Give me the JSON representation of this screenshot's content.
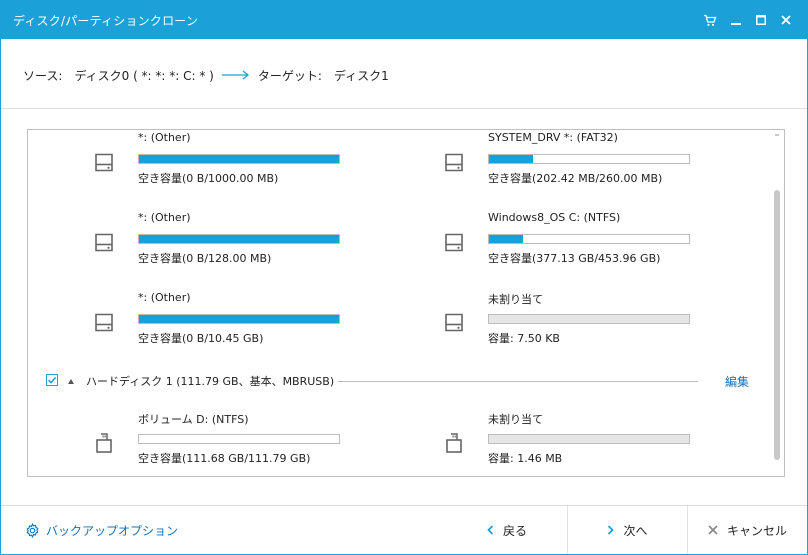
{
  "window": {
    "title": "ディスク/パーティションクローン",
    "accent": "#1ba1d8"
  },
  "source_target": {
    "source_label": "ソース:",
    "source_value": "ディスク0 ( *: *: *: C: * )",
    "target_label": "ターゲット:",
    "target_value": "ディスク1"
  },
  "disk0": {
    "partitions": [
      {
        "name": "*: (Other)",
        "capacity": "空き容量(0 B/1000.00 MB)",
        "used_fraction": 1.0,
        "unallocated": false
      },
      {
        "name": "SYSTEM_DRV *: (FAT32)",
        "capacity": "空き容量(202.42 MB/260.00 MB)",
        "used_fraction": 0.22,
        "unallocated": false
      },
      {
        "name": "*: (Other)",
        "capacity": "空き容量(0 B/128.00 MB)",
        "used_fraction": 1.0,
        "unallocated": false
      },
      {
        "name": "Windows8_OS C: (NTFS)",
        "capacity": "空き容量(377.13 GB/453.96 GB)",
        "used_fraction": 0.17,
        "unallocated": false
      },
      {
        "name": "*: (Other)",
        "capacity": "空き容量(0 B/10.45 GB)",
        "used_fraction": 1.0,
        "unallocated": false
      },
      {
        "name": "未割り当て",
        "capacity": "容量: 7.50 KB",
        "used_fraction": 0.0,
        "unallocated": true
      }
    ]
  },
  "disk1": {
    "label": "ハードディスク 1 (111.79 GB、基本、MBRUSB)",
    "edit_label": "編集",
    "checked": true,
    "partitions": [
      {
        "name": "ボリューム D: (NTFS)",
        "capacity": "空き容量(111.68 GB/111.79 GB)",
        "used_fraction": 0.0,
        "unallocated": false
      },
      {
        "name": "未割り当て",
        "capacity": "容量: 1.46 MB",
        "used_fraction": 0.0,
        "unallocated": true
      }
    ]
  },
  "footer": {
    "backup_options": "バックアップオプション",
    "back": "戻る",
    "next": "次へ",
    "cancel": "キャンセル"
  }
}
